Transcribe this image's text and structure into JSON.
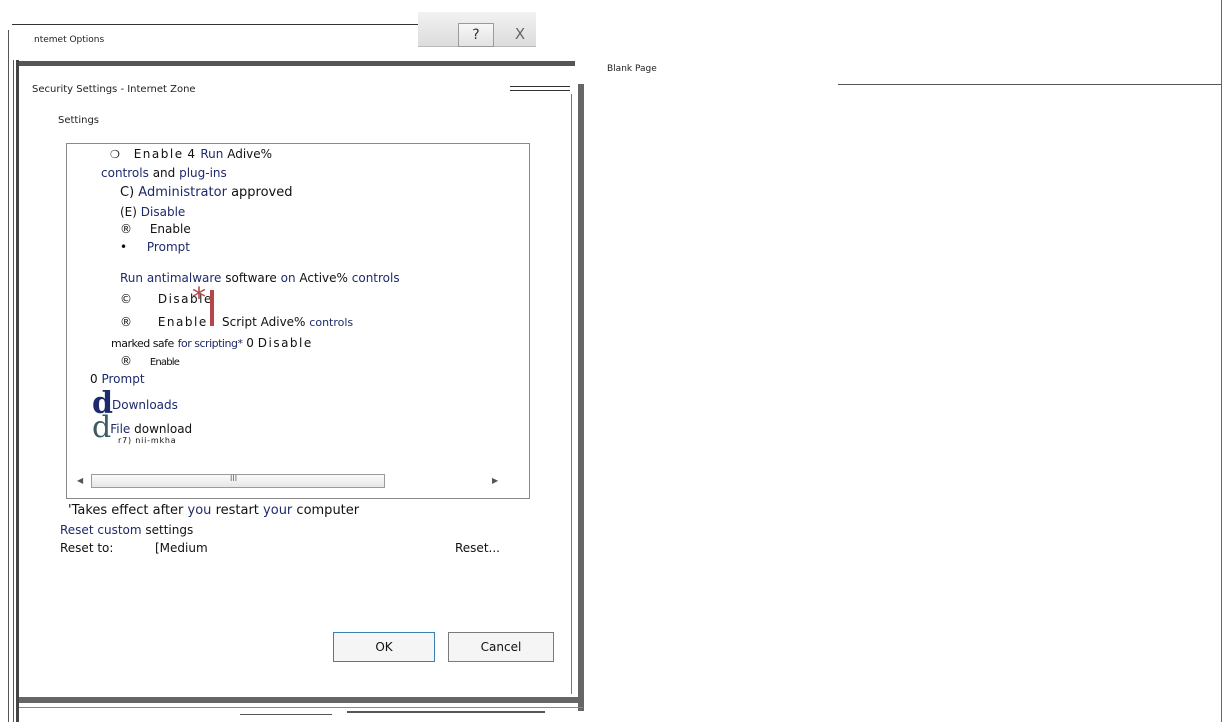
{
  "outer_window": {
    "title": "ntemet Options",
    "help_icon": "?",
    "close_icon": "X"
  },
  "right_panel": {
    "tab_label": "Blank Page"
  },
  "dialog": {
    "title": "Security Settings - Internet Zone",
    "settings_label": "Settings",
    "items": {
      "enable_run_activex": {
        "glyph": "❍",
        "word1": "Enable",
        "word2": "4",
        "word3": "Run",
        "word4": "Adive%"
      },
      "controls_plugins": {
        "a": "controls",
        "b": "and",
        "c": "plug-ins"
      },
      "admin_approved": {
        "a": "C)",
        "b": "Administrator",
        "c": "approved"
      },
      "disable_1": {
        "a": "(E)",
        "b": "Disable"
      },
      "enable_1": {
        "glyph": "®",
        "label": "Enable"
      },
      "prompt_1": {
        "glyph": "•",
        "label": "Prompt"
      },
      "run_antimalware": {
        "a": "Run antimalware",
        "b": "software",
        "c": "on",
        "d": "Active%",
        "e": "controls"
      },
      "disable_2": {
        "glyph": "©",
        "label": "Disable",
        "star": "*"
      },
      "enable_2": {
        "glyph": "®",
        "label": "Enable"
      },
      "script_activex": {
        "a": "Script Adive%",
        "b": "controls"
      },
      "marked_safe": {
        "a": "marked safe",
        "b": "for scripting*",
        "c": "0",
        "d": "Disable"
      },
      "enable_3": {
        "glyph": "®",
        "label": "Enable"
      },
      "prompt_2": {
        "a": "0",
        "b": "Prompt"
      },
      "downloads": {
        "icon": "d",
        "label": "Downloads"
      },
      "file_download": {
        "icon": "d",
        "a": "File",
        "b": "download"
      },
      "garbled": "r7) nii-mkha"
    },
    "scrollbar": {
      "grip": "III",
      "left_arrow": "◀",
      "right_arrow": "▶"
    },
    "footnote": {
      "a": "'Takes effect after",
      "b": "you",
      "c": "restart",
      "d": "your",
      "e": "computer"
    },
    "reset_section": {
      "a": "Reset",
      "b": "custom",
      "c": "settings"
    },
    "reset_to": {
      "label": "Reset to:",
      "value": "[Medium",
      "button": "Reset..."
    },
    "ok_label": "OK",
    "cancel_label": "Cancel"
  }
}
